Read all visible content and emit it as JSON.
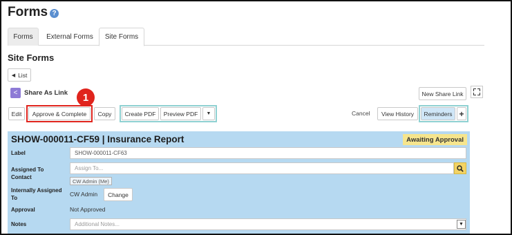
{
  "page": {
    "title": "Forms",
    "help_icon": "question-circle-icon"
  },
  "tabs": [
    {
      "label": "Forms"
    },
    {
      "label": "External Forms"
    },
    {
      "label": "Site Forms"
    }
  ],
  "section_title": "Site Forms",
  "list_button": {
    "icon": "caret-left-icon",
    "label": "List"
  },
  "share": {
    "icon": "share-icon",
    "label": "Share As Link",
    "new_link_label": "New Share Link",
    "fullscreen_icon": "fullscreen-icon"
  },
  "callout_badge": "1",
  "toolbar": {
    "edit": "Edit",
    "approve_complete": "Approve & Complete",
    "copy": "Copy",
    "create_pdf": "Create PDF",
    "preview_pdf": "Preview PDF",
    "more_icon": "caret-down-icon",
    "cancel": "Cancel",
    "view_history": "View History",
    "reminders": "Reminders",
    "add_icon": "plus-icon"
  },
  "colors": {
    "highlight_red": "#e0241d",
    "highlight_teal": "#8fd1d2",
    "panel_bg": "#b6d9f1",
    "status_bg": "#f6e58d"
  },
  "form": {
    "title": "SHOW-000011-CF59 | Insurance Report",
    "status": "Awaiting Approval",
    "label_label": "Label",
    "label_value": "SHOW-000011-CF63",
    "assigned_contact_label": "Assigned To Contact",
    "assigned_contact_placeholder": "Assign To...",
    "assigned_contact_chip": "CW Admin (Me)",
    "internal_label": "Internally Assigned To",
    "internal_value": "CW Admin",
    "change_button": "Change",
    "approval_label": "Approval",
    "approval_value": "Not Approved",
    "notes_label": "Notes",
    "notes_placeholder": "Additional Notes..."
  }
}
